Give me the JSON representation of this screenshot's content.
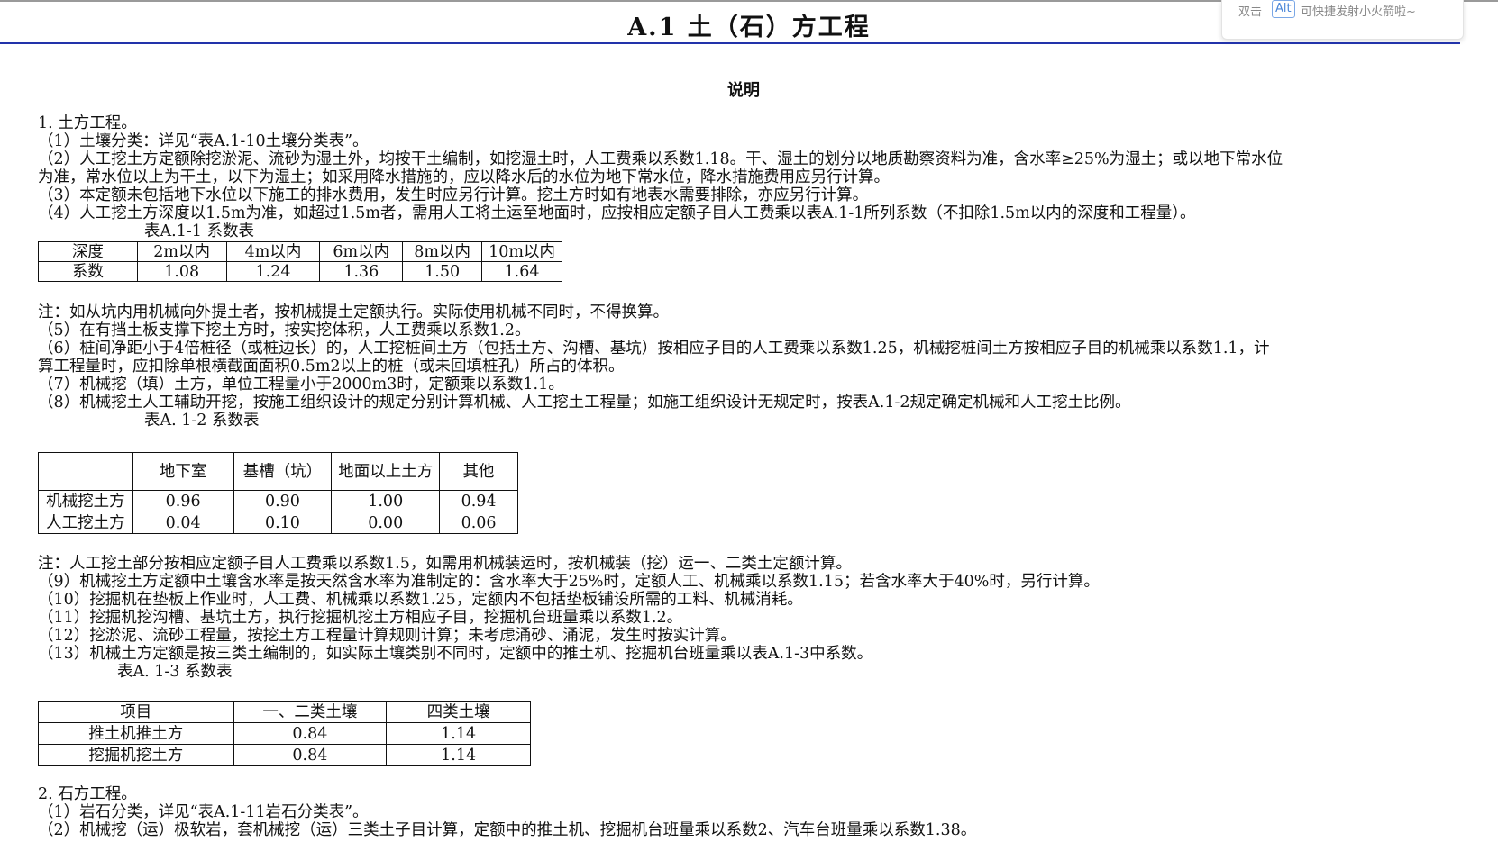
{
  "toast": {
    "prefix": "双击",
    "key": "Alt",
    "suffix": "可快捷发射小火箭啦~"
  },
  "title": "A.1 土（石）方工程",
  "subtitle": "说明",
  "lines": {
    "l1": "1. 土方工程。",
    "l2": "（1）土壤分类：详见“表A.1-10土壤分类表”。",
    "l3": "（2）人工挖土方定额除挖淤泥、流砂为湿土外，均按干土编制，如挖湿土时，人工费乘以系数1.18。干、湿土的划分以地质勘察资料为准，含水率≥25%为湿土；或以地下常水位",
    "l4": "为准，常水位以上为干土，以下为湿土；如采用降水措施的，应以降水后的水位为地下常水位，降水措施费用应另行计算。",
    "l5": "（3）本定额未包括地下水位以下施工的排水费用，发生时应另行计算。挖土方时如有地表水需要排除，亦应另行计算。",
    "l6": "（4）人工挖土方深度以1.5m为准，如超过1.5m者，需用人工将土运至地面时，应按相应定额子目人工费乘以表A.1-1所列系数（不扣除1.5m以内的深度和工程量）。",
    "t1cap": "表A.1-1 系数表",
    "n1": "注：如从坑内用机械向外提土者，按机械提土定额执行。实际使用机械不同时，不得换算。",
    "l7": "（5）在有挡土板支撑下挖土方时，按实挖体积，人工费乘以系数1.2。",
    "l8": "（6）桩间净距小于4倍桩径（或桩边长）的，人工挖桩间土方（包括土方、沟槽、基坑）按相应子目的人工费乘以系数1.25，机械挖桩间土方按相应子目的机械乘以系数1.1，计",
    "l9": "算工程量时，应扣除单根横截面面积0.5m2以上的桩（或未回填桩孔）所占的体积。",
    "l10": "（7）机械挖（填）土方，单位工程量小于2000m3时，定额乘以系数1.1。",
    "l11": "（8）机械挖土人工辅助开挖，按施工组织设计的规定分别计算机械、人工挖土工程量；如施工组织设计无规定时，按表A.1-2规定确定机械和人工挖土比例。",
    "t2cap": "表A. 1-2 系数表",
    "n2": "注：人工挖土部分按相应定额子目人工费乘以系数1.5，如需用机械装运时，按机械装（挖）运一、二类土定额计算。",
    "l12": "（9）机械挖土方定额中土壤含水率是按天然含水率为准制定的：含水率大于25%时，定额人工、机械乘以系数1.15；若含水率大于40%时，另行计算。",
    "l13": "（10）挖掘机在垫板上作业时，人工费、机械乘以系数1.25，定额内不包括垫板铺设所需的工料、机械消耗。",
    "l14": "（11）挖掘机挖沟槽、基坑土方，执行挖掘机挖土方相应子目，挖掘机台班量乘以系数1.2。",
    "l15": "（12）挖淤泥、流砂工程量，按挖土方工程量计算规则计算；未考虑涌砂、涌泥，发生时按实计算。",
    "l16": "（13）机械土方定额是按三类土编制的，如实际土壤类别不同时，定额中的推土机、挖掘机台班量乘以表A.1-3中系数。",
    "t3cap": "表A. 1-3 系数表",
    "l17": "2. 石方工程。",
    "l18": "（1）岩石分类，详见“表A.1-11岩石分类表”。",
    "l19": "（2）机械挖（运）极软岩，套机械挖（运）三类土子目计算，定额中的推土机、挖掘机台班量乘以系数2、汽车台班量乘以系数1.38。"
  },
  "table1": {
    "header": [
      "深度",
      "2m以内",
      "4m以内",
      "6m以内",
      "8m以内",
      "10m以内"
    ],
    "row": [
      "系数",
      "1.08",
      "1.24",
      "1.36",
      "1.50",
      "1.64"
    ]
  },
  "table2": {
    "header": [
      "",
      "地下室",
      "基槽（坑）",
      "地面以上土方",
      "其他"
    ],
    "rows": [
      [
        "机械挖土方",
        "0.96",
        "0.90",
        "1.00",
        "0.94"
      ],
      [
        "人工挖土方",
        "0.04",
        "0.10",
        "0.00",
        "0.06"
      ]
    ]
  },
  "table3": {
    "header": [
      "项目",
      "一、二类土壤",
      "四类土壤"
    ],
    "rows": [
      [
        "推土机推土方",
        "0.84",
        "1.14"
      ],
      [
        "挖掘机挖土方",
        "0.84",
        "1.14"
      ]
    ]
  }
}
